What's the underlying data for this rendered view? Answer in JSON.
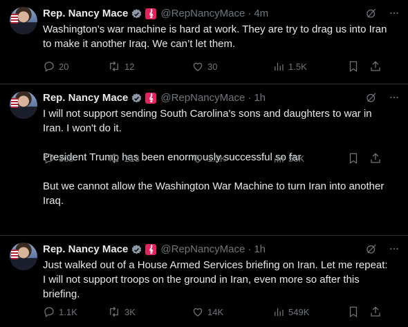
{
  "tweets": [
    {
      "name": "Rep. Nancy Mace",
      "handle": "@RepNancyMace",
      "time": "4m",
      "paragraphs": [
        "Washington’s war machine is hard at work. They are try to drag us into Iran to make it another Iraq. We can’t let them."
      ],
      "replies": "20",
      "reposts": "12",
      "likes": "30",
      "views": "1.5K"
    },
    {
      "name": "Rep. Nancy Mace",
      "handle": "@RepNancyMace",
      "time": "1h",
      "paragraphs": [
        "I will not support sending South Carolina's sons and daughters to war in Iran. I won't do it.",
        "President Trump has been enormously successful so far.",
        "But we cannot allow the Washington War Machine to turn Iran into another Iraq."
      ],
      "replies": "305",
      "reposts": "213",
      "likes": "1.2K",
      "views": "55K"
    },
    {
      "name": "Rep. Nancy Mace",
      "handle": "@RepNancyMace",
      "time": "1h",
      "paragraphs": [
        "Just walked out of a House Armed Services briefing on Iran. Let me repeat: I will not support troops on the ground in Iran, even more so after this briefing."
      ],
      "replies": "1.1K",
      "reposts": "3K",
      "likes": "14K",
      "views": "549K"
    }
  ],
  "separator": "·",
  "badge_glyph": "𝄞",
  "icons": {
    "verified": "verified-badge-icon",
    "flag_badge": "affiliation-badge-icon",
    "grok": "grok-icon",
    "more": "more-icon",
    "reply": "reply-icon",
    "repost": "repost-icon",
    "like": "like-icon",
    "views": "views-icon",
    "bookmark": "bookmark-icon",
    "share": "share-icon"
  },
  "colors": {
    "background": "#000000",
    "text": "#e7e9ea",
    "muted": "#71767b",
    "verified": "#8b98a5",
    "badge": "#e0245e"
  }
}
